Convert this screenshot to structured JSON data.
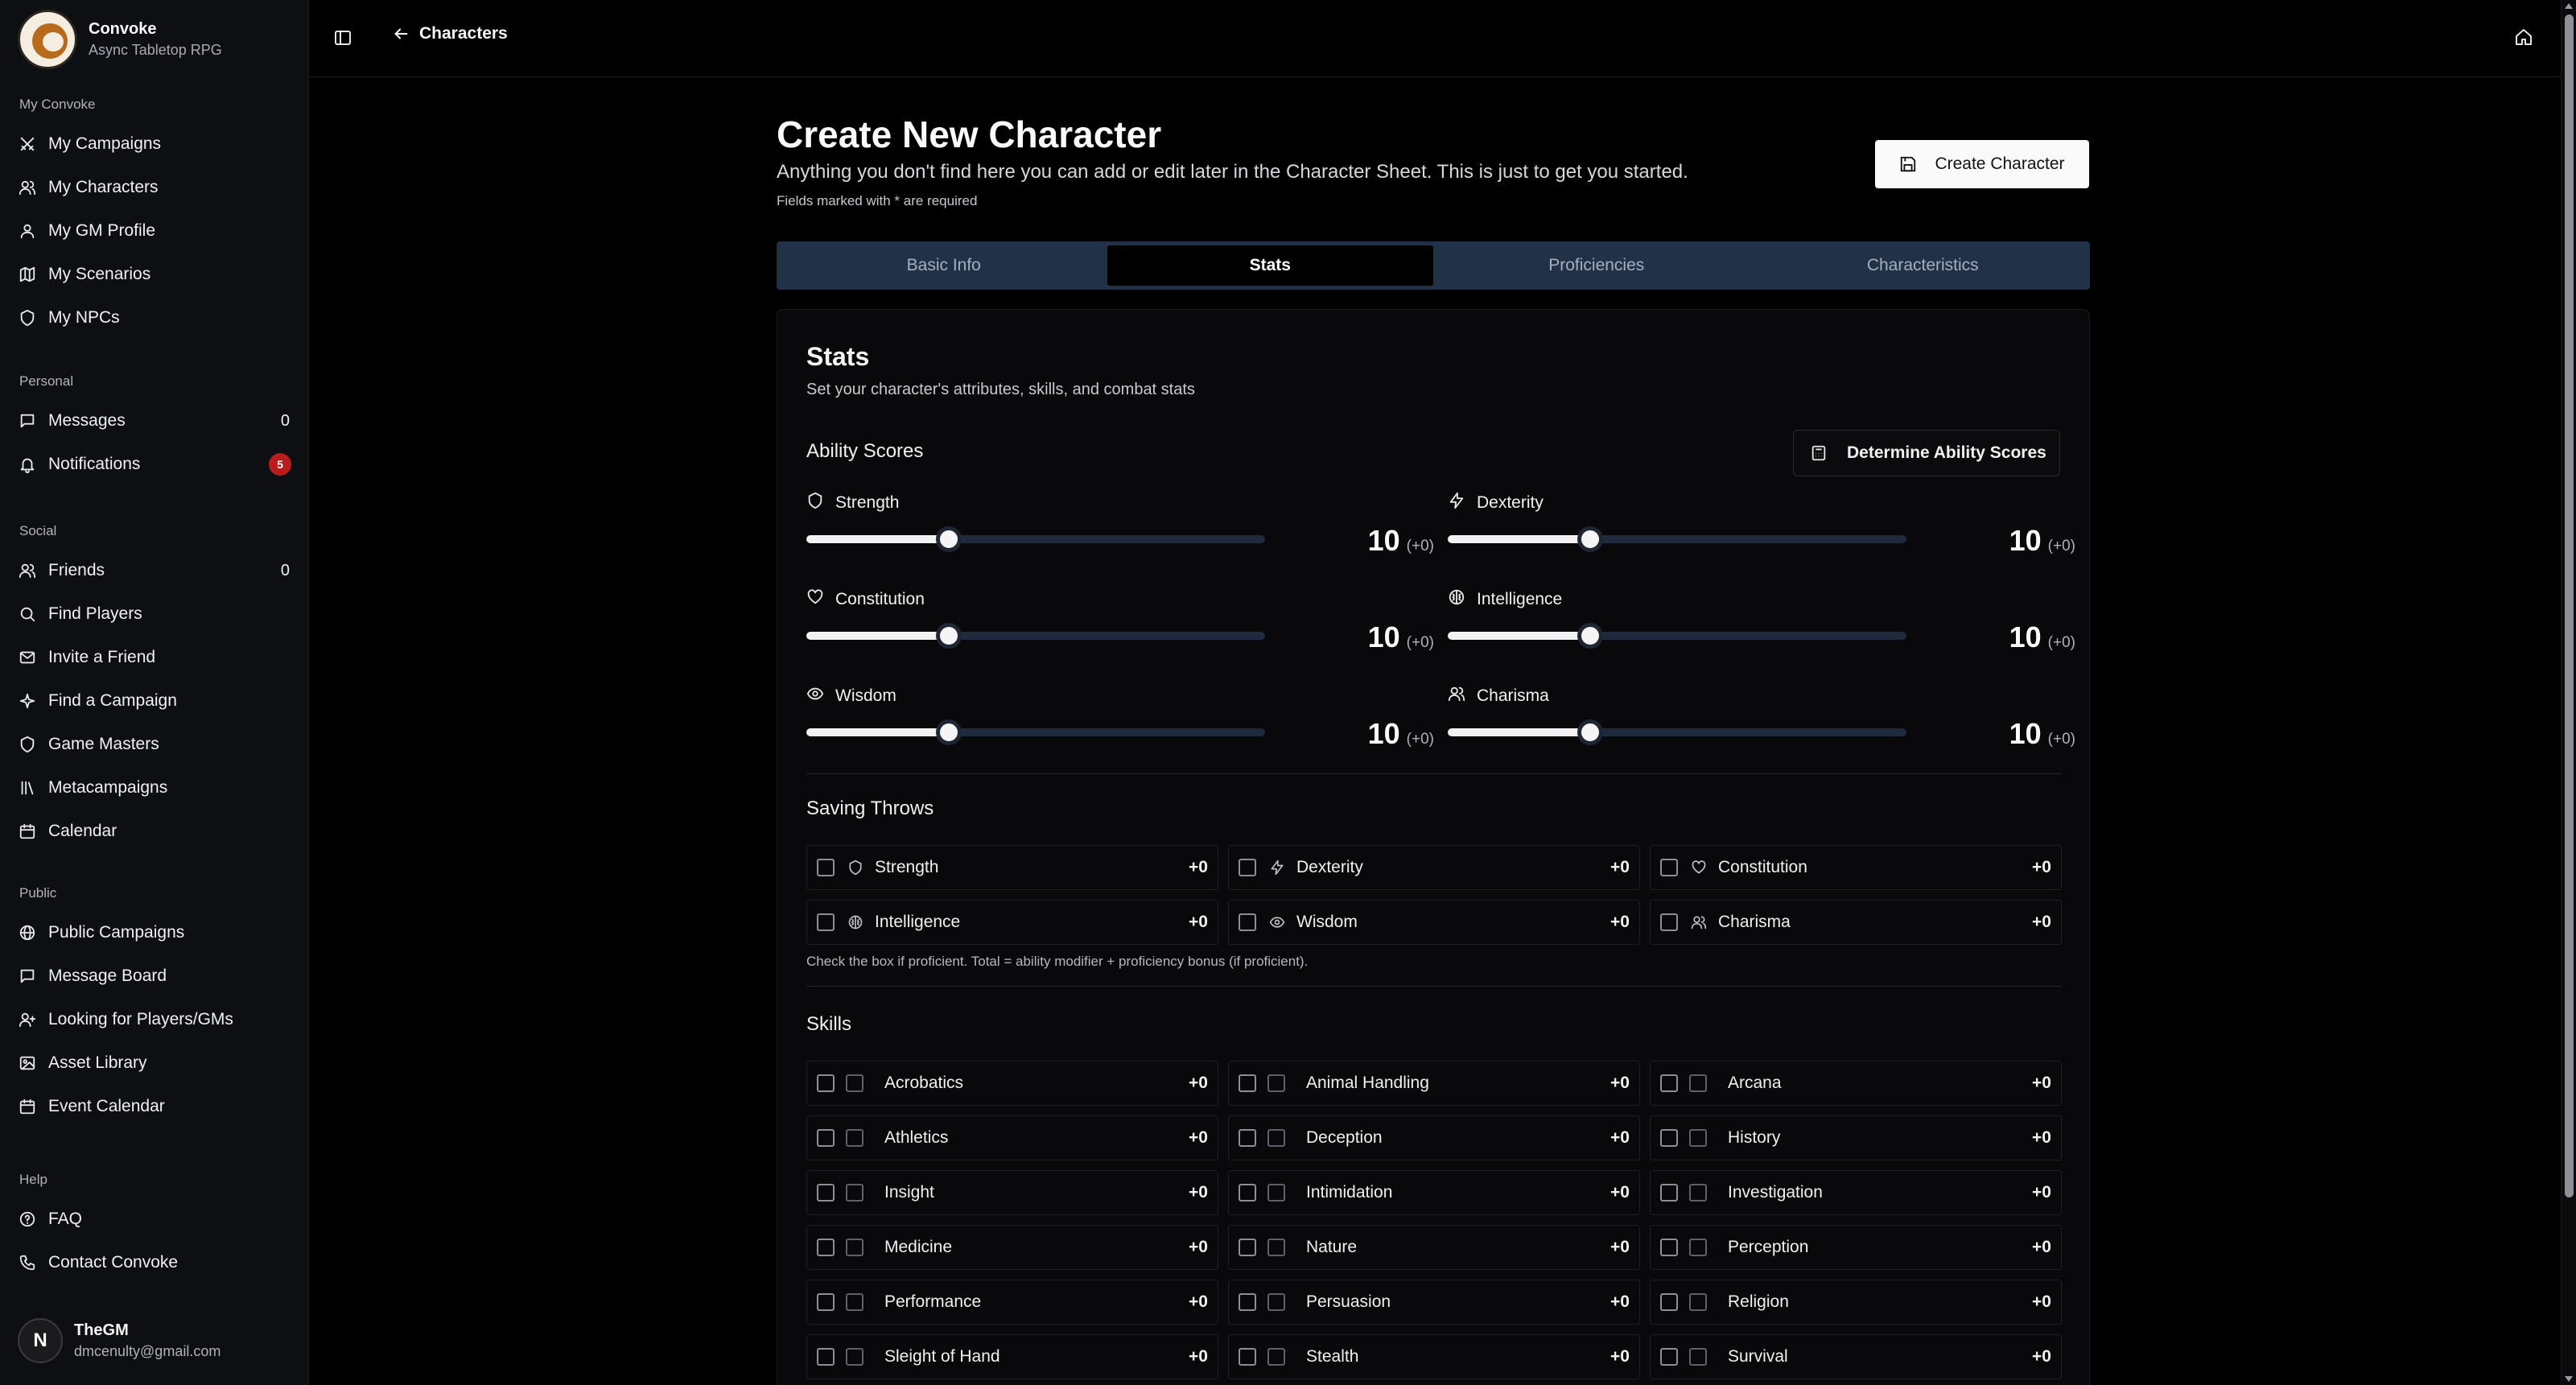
{
  "app": {
    "name": "Convoke",
    "subtitle": "Async Tabletop RPG"
  },
  "sidebar": {
    "sections": [
      {
        "label": "My Convoke",
        "items": [
          {
            "label": "My Campaigns",
            "icon": "swords-icon"
          },
          {
            "label": "My Characters",
            "icon": "users-icon"
          },
          {
            "label": "My GM Profile",
            "icon": "user-icon"
          },
          {
            "label": "My Scenarios",
            "icon": "map-icon"
          },
          {
            "label": "My NPCs",
            "icon": "shield-icon"
          }
        ]
      },
      {
        "label": "Personal",
        "items": [
          {
            "label": "Messages",
            "icon": "message-icon",
            "count": "0"
          },
          {
            "label": "Notifications",
            "icon": "bell-icon",
            "badge": "5"
          }
        ]
      },
      {
        "label": "Social",
        "items": [
          {
            "label": "Friends",
            "icon": "users-icon",
            "count": "0"
          },
          {
            "label": "Find Players",
            "icon": "search-icon"
          },
          {
            "label": "Invite a Friend",
            "icon": "mail-icon"
          },
          {
            "label": "Find a Campaign",
            "icon": "sparkles-icon"
          },
          {
            "label": "Game Masters",
            "icon": "shield-icon"
          },
          {
            "label": "Metacampaigns",
            "icon": "library-icon"
          },
          {
            "label": "Calendar",
            "icon": "calendar-icon"
          }
        ]
      },
      {
        "label": "Public",
        "items": [
          {
            "label": "Public Campaigns",
            "icon": "globe-icon"
          },
          {
            "label": "Message Board",
            "icon": "message-icon"
          },
          {
            "label": "Looking for Players/GMs",
            "icon": "user-plus-icon"
          },
          {
            "label": "Asset Library",
            "icon": "image-icon"
          },
          {
            "label": "Event Calendar",
            "icon": "calendar-icon"
          }
        ]
      },
      {
        "label": "Help",
        "items": [
          {
            "label": "FAQ",
            "icon": "help-circle-icon"
          },
          {
            "label": "Contact Convoke",
            "icon": "phone-icon"
          }
        ]
      }
    ],
    "user": {
      "initial": "N",
      "name": "TheGM",
      "email": "dmcenulty@gmail.com"
    }
  },
  "topbar": {
    "back_label": "Characters"
  },
  "page": {
    "title": "Create New Character",
    "subtitle": "Anything you don't find here you can add or edit later in the Character Sheet. This is just to get you started.",
    "note": "Fields marked with * are required",
    "create_label": "Create Character"
  },
  "tabs": [
    {
      "label": "Basic Info",
      "active": false
    },
    {
      "label": "Stats",
      "active": true
    },
    {
      "label": "Proficiencies",
      "active": false
    },
    {
      "label": "Characteristics",
      "active": false
    }
  ],
  "stats": {
    "title": "Stats",
    "subtitle": "Set your character's attributes, skills, and combat stats",
    "ability_scores_heading": "Ability Scores",
    "determine_label": "Determine Ability Scores",
    "slider_min": 1,
    "slider_max": 30,
    "abilities": [
      {
        "name": "Strength",
        "icon": "shield-icon",
        "value": "10",
        "modifier": "(+0)",
        "score": 10
      },
      {
        "name": "Dexterity",
        "icon": "zap-icon",
        "value": "10",
        "modifier": "(+0)",
        "score": 10
      },
      {
        "name": "Constitution",
        "icon": "heart-icon",
        "value": "10",
        "modifier": "(+0)",
        "score": 10
      },
      {
        "name": "Intelligence",
        "icon": "brain-icon",
        "value": "10",
        "modifier": "(+0)",
        "score": 10
      },
      {
        "name": "Wisdom",
        "icon": "eye-icon",
        "value": "10",
        "modifier": "(+0)",
        "score": 10
      },
      {
        "name": "Charisma",
        "icon": "users-icon",
        "value": "10",
        "modifier": "(+0)",
        "score": 10
      }
    ],
    "saving_throws_heading": "Saving Throws",
    "saving_throws": [
      {
        "name": "Strength",
        "icon": "shield-icon",
        "modifier": "+0"
      },
      {
        "name": "Dexterity",
        "icon": "zap-icon",
        "modifier": "+0"
      },
      {
        "name": "Constitution",
        "icon": "heart-icon",
        "modifier": "+0"
      },
      {
        "name": "Intelligence",
        "icon": "brain-icon",
        "modifier": "+0"
      },
      {
        "name": "Wisdom",
        "icon": "eye-icon",
        "modifier": "+0"
      },
      {
        "name": "Charisma",
        "icon": "users-icon",
        "modifier": "+0"
      }
    ],
    "saving_hint": "Check the box if proficient. Total = ability modifier + proficiency bonus (if proficient).",
    "skills_heading": "Skills",
    "skills": [
      {
        "name": "Acrobatics",
        "modifier": "+0"
      },
      {
        "name": "Animal Handling",
        "modifier": "+0"
      },
      {
        "name": "Arcana",
        "modifier": "+0"
      },
      {
        "name": "Athletics",
        "modifier": "+0"
      },
      {
        "name": "Deception",
        "modifier": "+0"
      },
      {
        "name": "History",
        "modifier": "+0"
      },
      {
        "name": "Insight",
        "modifier": "+0"
      },
      {
        "name": "Intimidation",
        "modifier": "+0"
      },
      {
        "name": "Investigation",
        "modifier": "+0"
      },
      {
        "name": "Medicine",
        "modifier": "+0"
      },
      {
        "name": "Nature",
        "modifier": "+0"
      },
      {
        "name": "Perception",
        "modifier": "+0"
      },
      {
        "name": "Performance",
        "modifier": "+0"
      },
      {
        "name": "Persuasion",
        "modifier": "+0"
      },
      {
        "name": "Religion",
        "modifier": "+0"
      },
      {
        "name": "Sleight of Hand",
        "modifier": "+0"
      },
      {
        "name": "Stealth",
        "modifier": "+0"
      },
      {
        "name": "Survival",
        "modifier": "+0"
      }
    ]
  },
  "colors": {
    "background": "#000000",
    "sidebar": "#0e0f12",
    "tab_bar": "#213147",
    "slider_track": "#1f2a3c",
    "badge": "#b91c1c"
  }
}
